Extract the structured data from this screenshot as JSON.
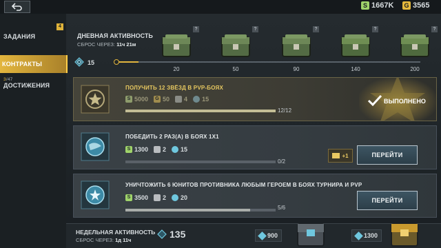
{
  "colors": {
    "accent": "#e3b63e",
    "silver": "#9fd36a",
    "gold": "#e5b83c",
    "points": "#6fc7de"
  },
  "topbar": {
    "back_icon": "back-arrow-icon",
    "silver": "1667K",
    "gold": "3565",
    "silver_icon_glyph": "S",
    "gold_icon_glyph": "G"
  },
  "sidebar": {
    "items": [
      {
        "label": "ЗАДАНИЯ",
        "badge": "4"
      },
      {
        "label": "КОНТРАКТЫ"
      },
      {
        "label": "ДОСТИЖЕНИЯ",
        "progress_current": "3",
        "progress_total": "/47"
      }
    ]
  },
  "daily": {
    "title": "ДНЕВНАЯ АКТИВНОСТЬ",
    "reset_label": "СБРОС ЧЕРЕЗ:",
    "reset_value": "11ч 21м",
    "points": "15",
    "progress_fraction": 0.075,
    "milestones": [
      "20",
      "50",
      "90",
      "140",
      "200"
    ],
    "chest_help": "?"
  },
  "contracts": [
    {
      "title": "ПОЛУЧИТЬ 12 ЗВЁЗД В PVP-БОЯХ",
      "rewards": {
        "silver": "5000",
        "gold": "50",
        "tokens": "4",
        "points": "15"
      },
      "progress_fraction": 1.0,
      "count": "12/12",
      "status": "ВЫПОЛНЕНО"
    },
    {
      "title": "ПОБЕДИТЬ 2 РАЗ(А) В БОЯХ 1X1",
      "rewards": {
        "silver": "1300",
        "tokens": "2",
        "points": "15"
      },
      "progress_fraction": 0.0,
      "count": "0/2",
      "ad_bonus": "+1",
      "button": "ПЕРЕЙТИ"
    },
    {
      "title": "УНИЧТОЖИТЬ 6 ЮНИТОВ ПРОТИВНИКА ЛЮБЫМ ГЕРОЕМ В БОЯХ ТУРНИРА И PVP",
      "rewards": {
        "silver": "3500",
        "tokens": "2",
        "points": "20"
      },
      "progress_fraction": 0.83,
      "count": "5/6",
      "button": "ПЕРЕЙТИ"
    }
  ],
  "weekly": {
    "title": "НЕДЕЛЬНАЯ АКТИВНОСТЬ",
    "reset_label": "СБРОС ЧЕРЕЗ:",
    "reset_value": "1д 11ч",
    "points": "135",
    "milestones": [
      "900",
      "1300"
    ]
  }
}
